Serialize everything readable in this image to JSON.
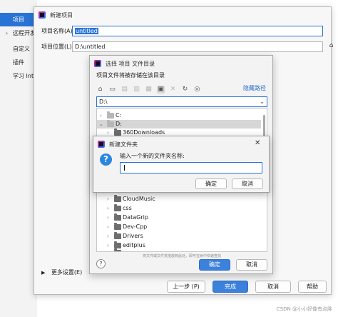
{
  "left_panel": {
    "items": [
      {
        "label": "项目",
        "active": true,
        "chevron": ""
      },
      {
        "label": "远程开发",
        "active": false,
        "chevron": "›"
      },
      {
        "label": "自定义",
        "active": false,
        "chevron": ""
      },
      {
        "label": "插件",
        "active": false,
        "chevron": ""
      },
      {
        "label": "学习 Inte",
        "active": false,
        "chevron": ""
      }
    ]
  },
  "new_project": {
    "title": "新建项目",
    "name_label": "项目名称(A):",
    "name_value": "untitled",
    "location_label": "项目位置(L):",
    "location_value": "D:\\untitled",
    "browse_label": "⌂",
    "more_settings": "更多设置(E)",
    "buttons": {
      "prev": "上一步 (P)",
      "finish": "完成",
      "cancel": "取消",
      "help": "帮助"
    }
  },
  "select_folder": {
    "title": "选择 项目 文件目录",
    "description": "项目文件将被存储在该目录",
    "hide_path": "隐藏路径",
    "path_value": "D:\\",
    "tree": [
      {
        "label": "C:",
        "level": 0,
        "expanded": false,
        "selected": false,
        "folder": "light"
      },
      {
        "label": "D:",
        "level": 0,
        "expanded": true,
        "selected": true,
        "folder": "light"
      },
      {
        "label": "360Downloads",
        "level": 1,
        "expanded": false,
        "selected": false,
        "folder": "dark"
      },
      {
        "label": "",
        "level": 1,
        "expanded": false,
        "selected": false,
        "folder": "dark"
      },
      {
        "label": "",
        "level": 1,
        "expanded": false,
        "selected": false,
        "folder": "dark"
      },
      {
        "label": "",
        "level": 1,
        "expanded": false,
        "selected": false,
        "folder": "dark"
      },
      {
        "label": "",
        "level": 1,
        "expanded": false,
        "selected": false,
        "folder": "dark"
      },
      {
        "label": "",
        "level": 1,
        "expanded": false,
        "selected": false,
        "folder": "dark"
      },
      {
        "label": "CloudMusic",
        "level": 1,
        "expanded": false,
        "selected": false,
        "folder": "dark"
      },
      {
        "label": "css",
        "level": 1,
        "expanded": false,
        "selected": false,
        "folder": "dark"
      },
      {
        "label": "DataGrip",
        "level": 1,
        "expanded": false,
        "selected": false,
        "folder": "dark"
      },
      {
        "label": "Dev-Cpp",
        "level": 1,
        "expanded": false,
        "selected": false,
        "folder": "dark"
      },
      {
        "label": "Drivers",
        "level": 1,
        "expanded": false,
        "selected": false,
        "folder": "dark"
      },
      {
        "label": "editplus",
        "level": 1,
        "expanded": false,
        "selected": false,
        "folder": "dark"
      }
    ],
    "drag_hint": "将文件或文件夹拖放到此处，即可在树中快速查找",
    "help_label": "?",
    "ok": "确定",
    "cancel": "取消"
  },
  "new_folder": {
    "title": "新建文件夹",
    "close": "✕",
    "prompt": "输入一个新的文件夹名称:",
    "input_value": "",
    "icon_glyph": "?",
    "ok": "确定",
    "cancel": "取消"
  },
  "watermark": "CSDN @小小好像有点胖",
  "colors": {
    "accent": "#2a73d6",
    "primary_button": "#3c81db",
    "link": "#2a6fce"
  }
}
